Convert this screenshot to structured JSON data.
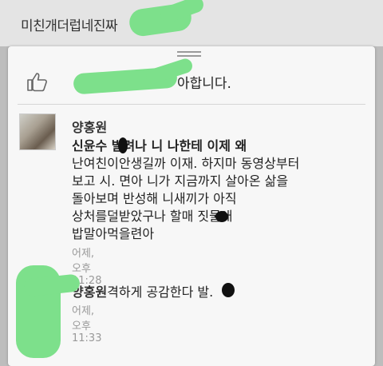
{
  "top_card": {
    "text": "미친개더럽네진짜"
  },
  "like": {
    "icon": "thumbs-up-icon",
    "text": "아합니다."
  },
  "comments": [
    {
      "author": "양홍원",
      "lines": [
        "신윤수  발려나 니 나한테 이제 왜",
        "난여친이안생길까 이재. 하지마 동영상부터",
        "보고 시. 면아 니가 지금까지 살아온 삶을",
        "돌아보며 반성해 니새끼가 아직",
        "상처를덜받았구나 할매   짓물애",
        "밥말아먹을련아"
      ],
      "time": "어제, 오후 11:28"
    },
    {
      "author": "양홍원",
      "text": "격하게 공감한다  발.",
      "time": "어제, 오후 11:33"
    }
  ],
  "colors": {
    "scribble": "#7de08b",
    "panel": "#f7f7f7",
    "background": "#bdbdbd"
  }
}
